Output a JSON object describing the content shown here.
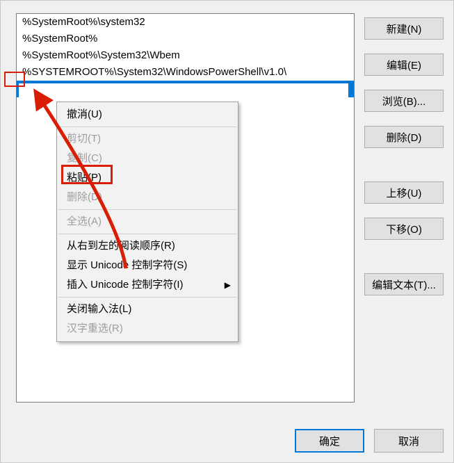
{
  "list": {
    "items": [
      "%SystemRoot%\\system32",
      "%SystemRoot%",
      "%SystemRoot%\\System32\\Wbem",
      "%SYSTEMROOT%\\System32\\WindowsPowerShell\\v1.0\\"
    ],
    "editing_value": ""
  },
  "side": {
    "new": "新建(N)",
    "edit": "编辑(E)",
    "browse": "浏览(B)...",
    "delete": "删除(D)",
    "moveup": "上移(U)",
    "movedown": "下移(O)",
    "edittext": "编辑文本(T)..."
  },
  "footer": {
    "ok": "确定",
    "cancel": "取消"
  },
  "menu": {
    "undo": "撤消(U)",
    "cut": "剪切(T)",
    "copy": "复制(C)",
    "paste": "粘贴(P)",
    "del": "删除(D)",
    "selectall": "全选(A)",
    "rtl": "从右到左的阅读顺序(R)",
    "showunicode": "显示 Unicode 控制字符(S)",
    "insertunicode": "插入 Unicode 控制字符(I)",
    "closeime": "关闭输入法(L)",
    "imereconv": "汉字重选(R)"
  }
}
